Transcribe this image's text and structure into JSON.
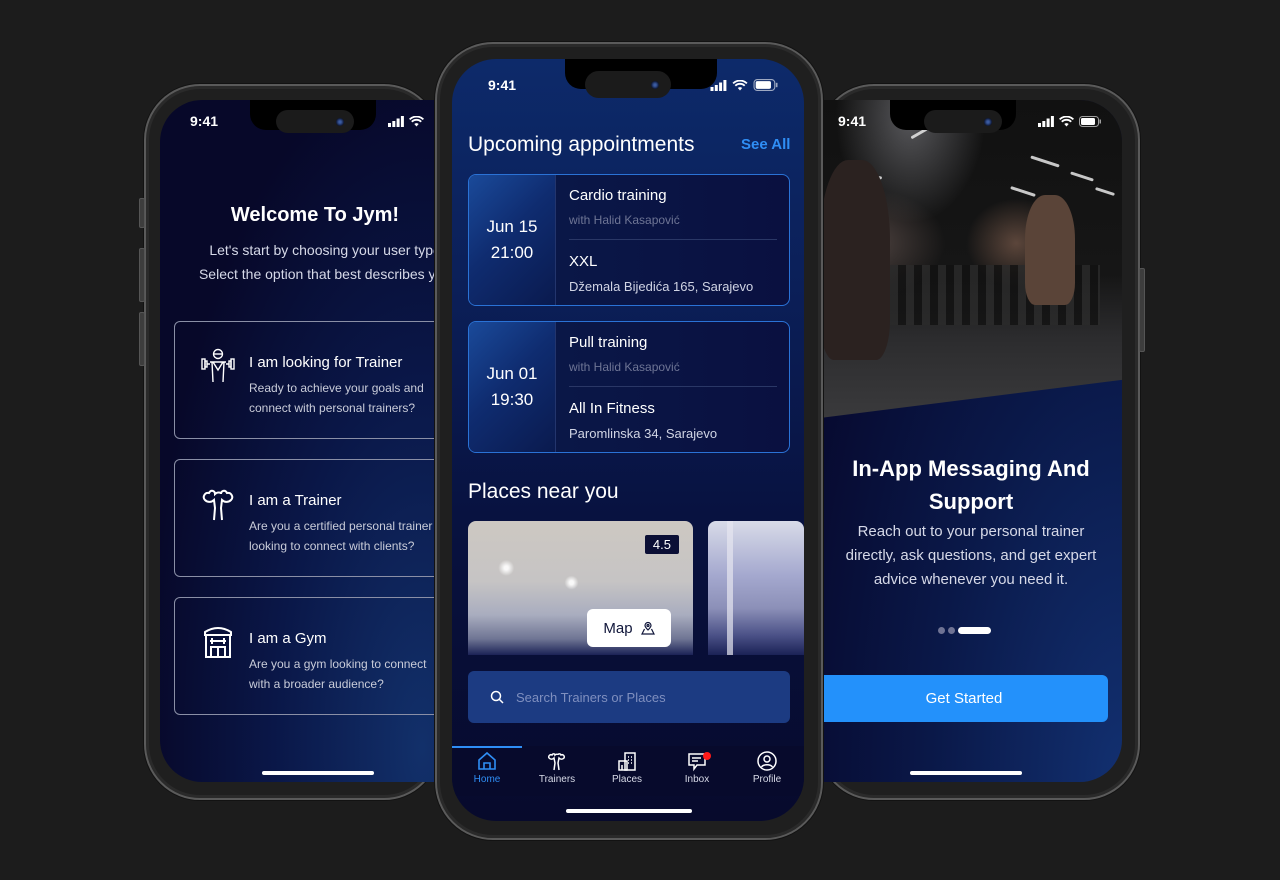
{
  "status_bar": {
    "time": "9:41"
  },
  "left_screen": {
    "title": "Welcome To Jym!",
    "subtitle_line1": "Let's start by choosing your user type.",
    "subtitle_line2": "Select the option that best describes you.",
    "roles": [
      {
        "icon": "trainer-weights-icon",
        "title": "I am looking for Trainer",
        "desc_line1": "Ready to achieve your goals and",
        "desc_line2": "connect with personal trainers?"
      },
      {
        "icon": "flexing-arms-icon",
        "title": "I am a Trainer",
        "desc_line1": "Are you a certified personal trainer",
        "desc_line2": "looking to connect with clients?"
      },
      {
        "icon": "gym-building-icon",
        "title": "I am a Gym",
        "desc_line1": "Are you a gym looking to connect",
        "desc_line2": "with a broader audience?"
      }
    ]
  },
  "home_screen": {
    "appointments_title": "Upcoming appointments",
    "see_all": "See All",
    "appointments": [
      {
        "date": "Jun 15",
        "time": "21:00",
        "training": "Cardio training",
        "trainer": "with Halid Kasapović",
        "place": "XXL",
        "address": "Džemala Bijedića 165, Sarajevo"
      },
      {
        "date": "Jun 01",
        "time": "19:30",
        "training": "Pull training",
        "trainer": "with Halid Kasapović",
        "place": "All In Fitness",
        "address": "Paromlinska 34, Sarajevo"
      }
    ],
    "places_title": "Places near you",
    "places": [
      {
        "rating": "4.5"
      },
      {
        "rating": ""
      }
    ],
    "map_button": "Map",
    "search_placeholder": "Search Trainers or Places",
    "tabs": [
      {
        "label": "Home",
        "icon": "home-icon",
        "active": true
      },
      {
        "label": "Trainers",
        "icon": "trainers-icon",
        "active": false
      },
      {
        "label": "Places",
        "icon": "places-icon",
        "active": false
      },
      {
        "label": "Inbox",
        "icon": "inbox-icon",
        "active": false,
        "badge": true
      },
      {
        "label": "Profile",
        "icon": "profile-icon",
        "active": false
      }
    ],
    "accent_color": "#2f8ef5",
    "badge_color": "#ff1a1a"
  },
  "onboarding_screen": {
    "title_line1": "In-App Messaging And",
    "title_line2": "Support",
    "desc_line1": "Reach out to your personal trainer",
    "desc_line2": "directly, ask questions, and get expert",
    "desc_line3": "advice whenever you need it.",
    "pager": {
      "total": 3,
      "current": 3
    },
    "cta": "Get Started",
    "cta_color": "#2391fb"
  }
}
